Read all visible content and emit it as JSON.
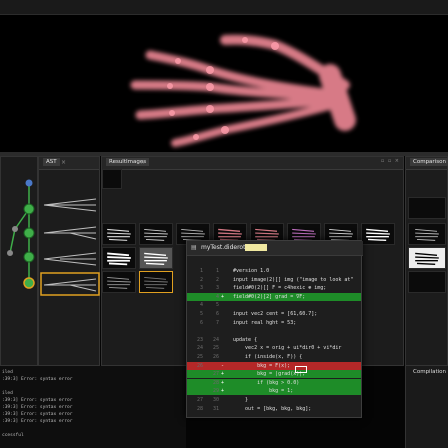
{
  "colors": {
    "accent_orange": "#e0a020",
    "diff_added": "#1e8c28",
    "diff_removed": "#b42828",
    "node_green": "#3fae49",
    "node_blue": "#4a78c8"
  },
  "panels": {
    "ast": {
      "tab": "AST"
    },
    "results": {
      "tab": "ResultImages"
    },
    "comparison": {
      "tab": "Comparison"
    }
  },
  "editor": {
    "title": "myTest.diderot",
    "lines": [
      {
        "n1": "1",
        "n2": "1",
        "mark": "",
        "text": "#version 1.0",
        "state": ""
      },
      {
        "n1": "2",
        "n2": "2",
        "mark": "",
        "text": "input image(2)[] img (\"image to look at\"",
        "state": ""
      },
      {
        "n1": "3",
        "n2": "3",
        "mark": "",
        "text": "field#0(2)[] F = c4hexic ⊛ img;",
        "state": ""
      },
      {
        "n1": "",
        "n2": "4",
        "mark": "+",
        "text": "field#0(2)[2] grad = ∇F;",
        "state": "added"
      },
      {
        "n1": "4",
        "n2": "5",
        "mark": "",
        "text": "",
        "state": ""
      },
      {
        "n1": "5",
        "n2": "6",
        "mark": "",
        "text": "input vec2 cent = [61,60.7];",
        "state": ""
      },
      {
        "n1": "6",
        "n2": "7",
        "mark": "",
        "text": "input real hght = 53;",
        "state": ""
      },
      {
        "n1": "",
        "n2": "",
        "mark": "",
        "text": "",
        "state": ""
      },
      {
        "n1": "23",
        "n2": "24",
        "mark": "",
        "text": "update {",
        "state": ""
      },
      {
        "n1": "24",
        "n2": "25",
        "mark": "",
        "text": "    vec2 x = orig + ui*dir0 + vi*dir",
        "state": ""
      },
      {
        "n1": "25",
        "n2": "26",
        "mark": "",
        "text": "    if (inside(x, F)) {",
        "state": ""
      },
      {
        "n1": "26",
        "n2": "",
        "mark": "-",
        "text": "        bkg = F(x);",
        "state": "removed"
      },
      {
        "n1": "",
        "n2": "27",
        "mark": "+",
        "text": "        bkg = |grad(x)|;",
        "state": "added"
      },
      {
        "n1": "",
        "n2": "28",
        "mark": "+",
        "text": "        if (bkg > 0.0)",
        "state": "added"
      },
      {
        "n1": "",
        "n2": "29",
        "mark": "+",
        "text": "            bkg = 1;",
        "state": "added"
      },
      {
        "n1": "27",
        "n2": "30",
        "mark": "",
        "text": "    }",
        "state": ""
      },
      {
        "n1": "28",
        "n2": "31",
        "mark": "",
        "text": "    out = [bkg, bkg, bkg];",
        "state": ""
      }
    ]
  },
  "log": {
    "lines": [
      "iled",
      ":39:3] Error: syntax error",
      "",
      "iled",
      ":39:3] Error: syntax error",
      ":39:3] Error: syntax error",
      ":39:3] Error: syntax error",
      ":39:3] Error: syntax error",
      "",
      "ccessful"
    ]
  },
  "compile": {
    "label": "Compilation"
  }
}
